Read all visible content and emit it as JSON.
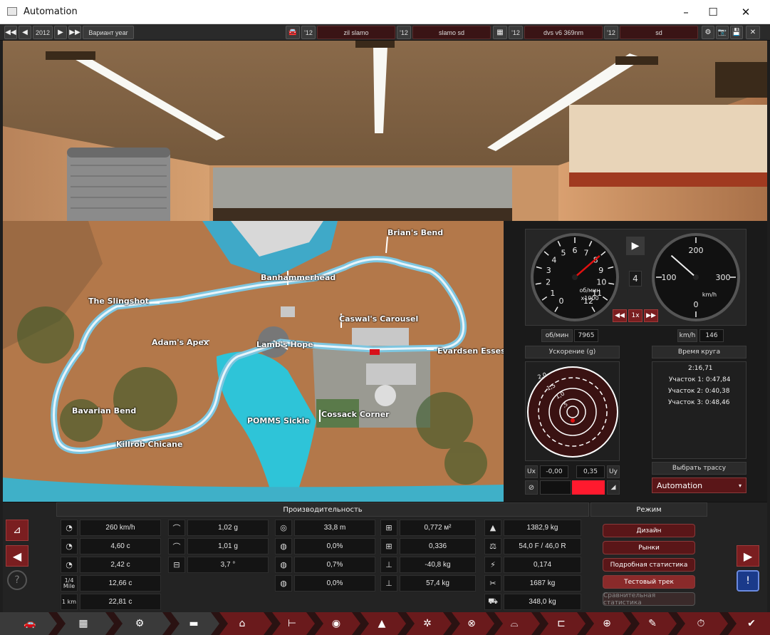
{
  "window": {
    "title": "Automation",
    "minimize": "–",
    "maximize": "☐",
    "close": "✕"
  },
  "toolbar": {
    "year": "2012",
    "variant_label": "Вариант year",
    "car_year": "'12",
    "car_model": "zil slamo",
    "trim_year": "'12",
    "trim_name": "slamo sd",
    "engine_year": "'12",
    "engine_name": "dvs v6 369nm",
    "variant_year": "'12",
    "variant_name": "sd"
  },
  "map": {
    "labels": [
      "Brian's Bend",
      "Banhammerhead",
      "The Slingshot",
      "Caswal's Carousel",
      "Adam's Apex",
      "Lamb's Hope",
      "Evardsen Esses",
      "Bavarian Bend",
      "POMMS Sickle",
      "Cossack Corner",
      "Killrob Chicane"
    ]
  },
  "gauges": {
    "rpm_unit": "об/мин",
    "rpm_mult": "x1000",
    "rpm_ticks": [
      "0",
      "1",
      "2",
      "3",
      "4",
      "5",
      "6",
      "7",
      "8",
      "9",
      "10",
      "11",
      "12"
    ],
    "speed_unit": "km/h",
    "speed_ticks": [
      "0",
      "100",
      "200",
      "300"
    ],
    "gear": "4",
    "speed_ctrl": "1x",
    "rpm_label": "об/мин",
    "rpm_value": "7965",
    "speed_label": "km/h",
    "speed_value": "146",
    "rpm_needle_value": 7965,
    "speed_needle_value": 146
  },
  "accel": {
    "title": "Ускорение (g)",
    "rings": [
      "2,0",
      "1,5",
      "1,0",
      ",5"
    ],
    "x_label": "Ux",
    "x_value": "-0,00",
    "y_value": "0,35",
    "y_label": "Uy"
  },
  "lap": {
    "title": "Время круга",
    "total": "2:16,71",
    "sectors": [
      "Участок 1: 0:47,84",
      "Участок 2: 0:40,38",
      "Участок 3: 0:48,46"
    ],
    "track_button": "Выбрать трассу",
    "track_select": "Automation"
  },
  "performance": {
    "title": "Производительность",
    "col1": [
      "260 km/h",
      "4,60 с",
      "2,42 с",
      "12,66 с",
      "22,81 с"
    ],
    "col1_icons": [
      "1/4 Mile",
      "1 km"
    ],
    "col2": [
      "1,02 g",
      "1,01 g",
      "3,7 °"
    ],
    "col3": [
      "33,8 m",
      "0,0%",
      "0,7%",
      "0,0%"
    ],
    "col4": [
      "0,772 м²",
      "0,336",
      "-40,8 kg",
      "57,4 kg"
    ],
    "col5": [
      "1382,9 kg",
      "54,0 F / 46,0 R",
      "0,174",
      "1687 kg",
      "348,0 kg"
    ]
  },
  "mode": {
    "title": "Режим",
    "buttons": [
      "Дизайн",
      "Рынки",
      "Подробная статистика",
      "Тестовый трек",
      "Сравнительная статистика"
    ]
  },
  "colors": {
    "accent": "#7a1e20",
    "active": "#ff1a2e",
    "panel": "#232323"
  }
}
